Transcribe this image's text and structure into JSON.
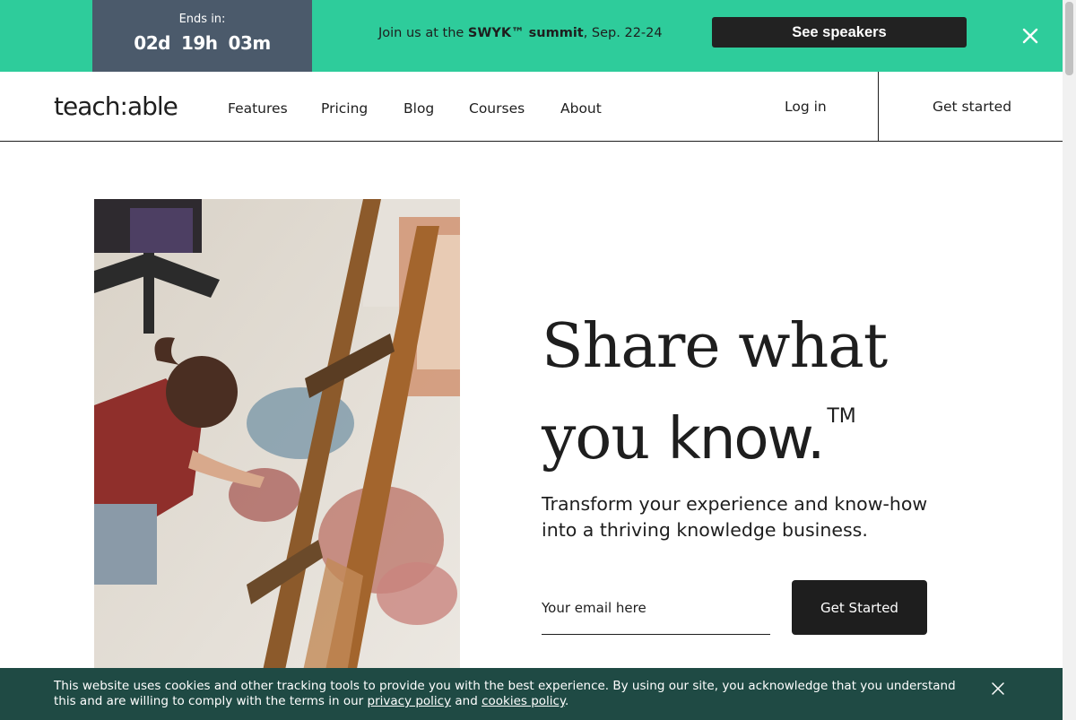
{
  "promo": {
    "ends_label": "Ends in:",
    "timer": {
      "days": "02d",
      "hours": "19h",
      "minutes": "03m"
    },
    "text_before": "Join us at the ",
    "text_bold": "SWYK™ summit",
    "text_after": ", Sep. 22-24",
    "button_label": "See speakers",
    "close_icon": "close-icon",
    "background_color": "#2ecc9b",
    "countdown_color": "#4b5a6b"
  },
  "nav": {
    "logo": "teach:able",
    "links": [
      "Features",
      "Pricing",
      "Blog",
      "Courses",
      "About"
    ],
    "login_label": "Log in",
    "get_started_label": "Get started"
  },
  "hero": {
    "headline_line1": "Share what",
    "headline_line2_serif": "you ",
    "headline_line2_sans": "know.",
    "trademark": "TM",
    "subheading": "Transform your experience and know-how into a thriving knowledge business.",
    "email_placeholder": "Your email here",
    "cta_label": "Get Started"
  },
  "cookie": {
    "text_before": "This website uses cookies and other tracking tools to provide you with the best experience. By using our site, you acknowledge that you understand this and are willing to comply with the terms in our ",
    "privacy_link": "privacy policy",
    "text_middle": " and ",
    "cookies_link": "cookies policy",
    "text_after": ".",
    "close_icon": "close-icon",
    "background_color": "#1f4a44"
  }
}
